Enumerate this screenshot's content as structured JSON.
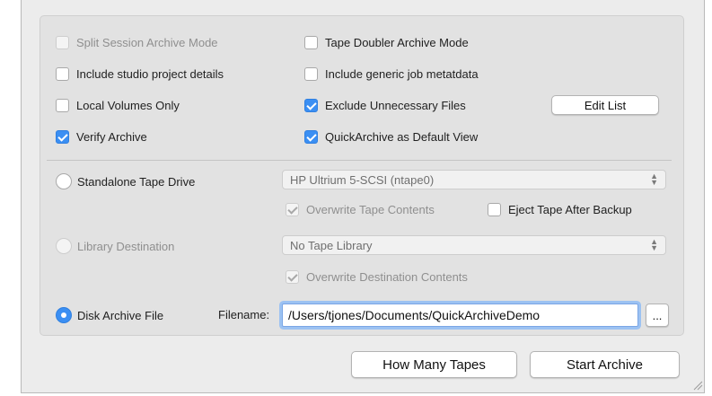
{
  "options": {
    "split_session": {
      "label": "Split Session Archive Mode",
      "checked": false,
      "enabled": false
    },
    "tape_doubler": {
      "label": "Tape Doubler Archive Mode",
      "checked": false,
      "enabled": true
    },
    "include_studio": {
      "label": "Include studio project details",
      "checked": false,
      "enabled": true
    },
    "include_generic": {
      "label": "Include generic job metatdata",
      "checked": false,
      "enabled": true
    },
    "local_volumes": {
      "label": "Local Volumes Only",
      "checked": false,
      "enabled": true
    },
    "exclude_files": {
      "label": "Exclude Unnecessary Files",
      "checked": true,
      "enabled": true
    },
    "verify_archive": {
      "label": "Verify Archive",
      "checked": true,
      "enabled": true
    },
    "quickarchive_default": {
      "label": "QuickArchive as Default View",
      "checked": true,
      "enabled": true
    }
  },
  "edit_list_label": "Edit List",
  "destinations": {
    "standalone": {
      "label": "Standalone Tape Drive",
      "selected": false,
      "drive_value": "HP Ultrium 5-SCSI (ntape0)",
      "overwrite_label": "Overwrite Tape Contents",
      "eject_label": "Eject Tape After Backup"
    },
    "library": {
      "label": "Library Destination",
      "selected": false,
      "library_value": "No Tape Library",
      "overwrite_label": "Overwrite Destination Contents"
    },
    "disk": {
      "label": "Disk Archive File",
      "selected": true,
      "filename_label": "Filename:",
      "filename_value": "/Users/tjones/Documents/QuickArchiveDemo",
      "browse_label": "..."
    }
  },
  "buttons": {
    "how_many": "How Many Tapes",
    "start": "Start Archive"
  },
  "colors": {
    "accent": "#3b8ff3",
    "window_bg": "#ececec",
    "group_bg": "#e2e2e2"
  }
}
